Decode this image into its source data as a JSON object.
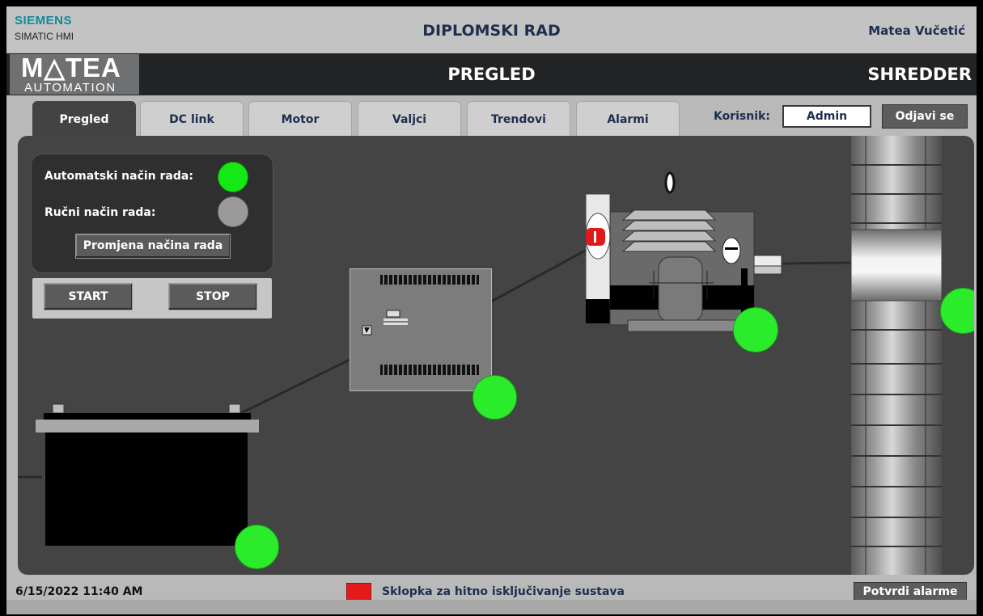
{
  "topbar": {
    "brand": "SIEMENS",
    "product": "SIMATIC HMI",
    "title": "DIPLOMSKI RAD",
    "author": "Matea Vučetić"
  },
  "header": {
    "logo_name": "M△TEA",
    "logo_sub": "AUTOMATION",
    "screen_title": "PREGLED",
    "machine": "SHREDDER"
  },
  "tabs": [
    {
      "label": "Pregled",
      "active": true
    },
    {
      "label": "DC link",
      "active": false
    },
    {
      "label": "Motor",
      "active": false
    },
    {
      "label": "Valjci",
      "active": false
    },
    {
      "label": "Trendovi",
      "active": false
    },
    {
      "label": "Alarmi",
      "active": false
    }
  ],
  "user": {
    "label": "Korisnik:",
    "value": "Admin",
    "logout": "Odjavi se"
  },
  "mode": {
    "auto_label": "Automatski način rada:",
    "auto_state": "on",
    "manual_label": "Ručni način rada:",
    "manual_state": "off",
    "change_button": "Promjena načina rada"
  },
  "controls": {
    "start": "START",
    "stop": "STOP"
  },
  "statuses": {
    "battery": "ok",
    "dc_link": "ok",
    "motor": "ok",
    "rollers": "ok"
  },
  "colors": {
    "status_ok": "#2bec2b",
    "lamp_on": "#16e816",
    "lamp_off": "#9a9a9a",
    "alarm": "#e41a1a",
    "title_text": "#1e2e4e"
  },
  "footer": {
    "datetime": "6/15/2022 11:40 AM",
    "alarm_text": "Sklopka za hitno isključivanje sustava",
    "ack_button": "Potvrdi alarme"
  }
}
